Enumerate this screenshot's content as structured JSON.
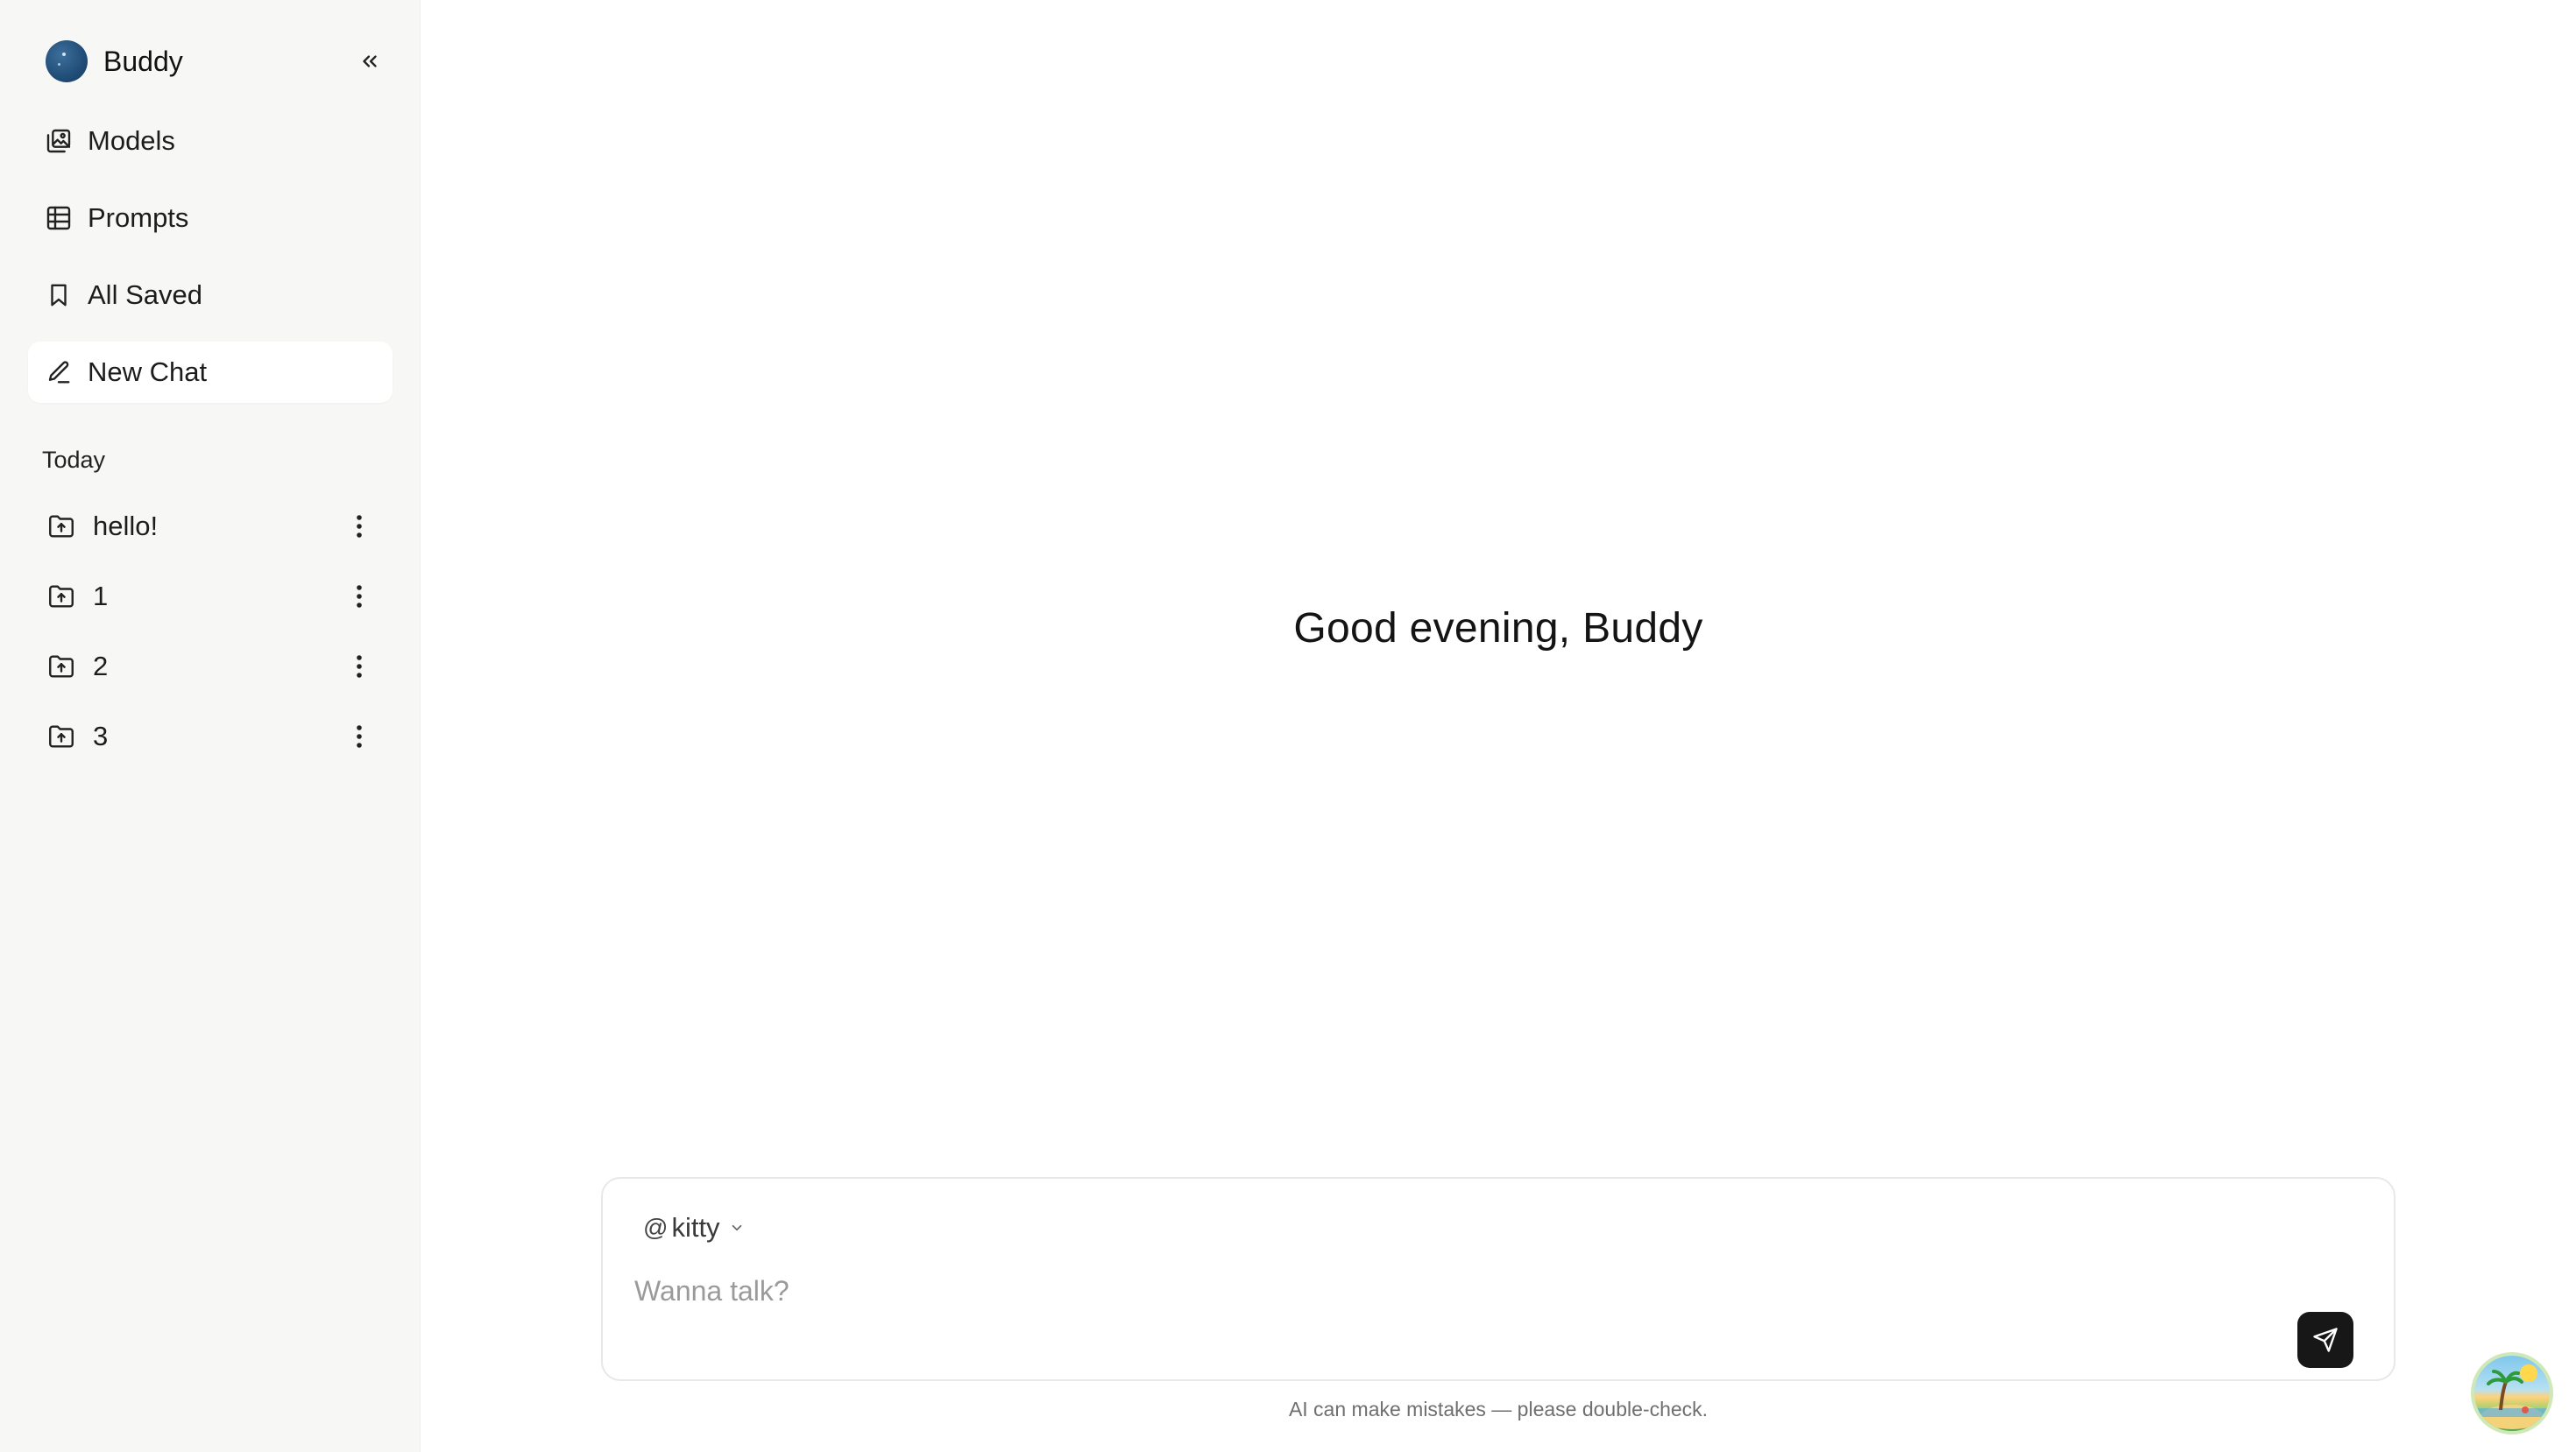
{
  "sidebar": {
    "brand_name": "Buddy",
    "nav": [
      {
        "label": "Models",
        "icon": "models-icon"
      },
      {
        "label": "Prompts",
        "icon": "prompts-icon"
      },
      {
        "label": "All Saved",
        "icon": "bookmark-icon"
      },
      {
        "label": "New Chat",
        "icon": "pencil-icon",
        "active": true
      }
    ],
    "section_title": "Today",
    "chats": [
      {
        "label": "hello!"
      },
      {
        "label": "1"
      },
      {
        "label": "2"
      },
      {
        "label": "3"
      }
    ]
  },
  "main": {
    "greeting": "Good evening, Buddy",
    "composer": {
      "model_prefix": "@",
      "model_name": "kitty",
      "placeholder": "Wanna talk?"
    },
    "disclaimer": "AI can make mistakes — please double-check."
  },
  "colors": {
    "sidebar_bg": "#f7f7f5",
    "send_button_bg": "#171717",
    "active_item_bg": "#ffffff"
  }
}
